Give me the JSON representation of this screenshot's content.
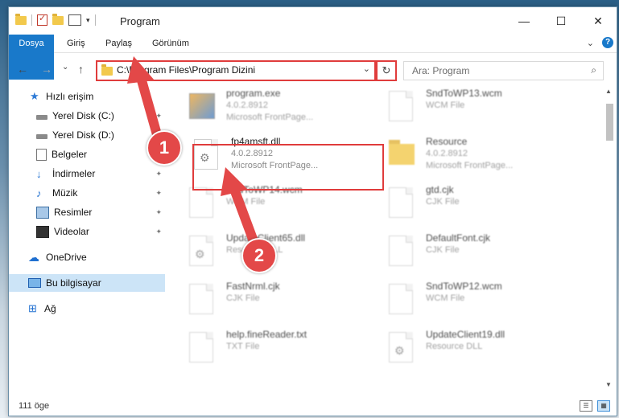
{
  "window": {
    "title": "Program",
    "controls": {
      "minimize": "—",
      "maximize": "☐",
      "close": "✕"
    }
  },
  "ribbon": {
    "tabs": [
      "Dosya",
      "Giriş",
      "Paylaş",
      "Görünüm"
    ],
    "help": "?",
    "expand": "⌄"
  },
  "nav": {
    "back": "←",
    "forward": "→",
    "recent": "⌄",
    "up": "↑",
    "address": "C:\\Program Files\\Program Dizini",
    "address_dropdown": "⌄",
    "refresh": "↻",
    "search_placeholder": "Ara: Program",
    "search_icon": "⌕"
  },
  "sidebar": {
    "items": [
      {
        "label": "Hızlı erişim",
        "icon": "star-icon"
      },
      {
        "label": "Yerel Disk (C:)",
        "icon": "disk-icon",
        "pinned": true
      },
      {
        "label": "Yerel Disk (D:)",
        "icon": "disk-icon",
        "pinned": true
      },
      {
        "label": "Belgeler",
        "icon": "documents-icon",
        "pinned": true
      },
      {
        "label": "İndirmeler",
        "icon": "downloads-icon",
        "pinned": true
      },
      {
        "label": "Müzik",
        "icon": "music-icon",
        "pinned": true
      },
      {
        "label": "Resimler",
        "icon": "pictures-icon",
        "pinned": true
      },
      {
        "label": "Videolar",
        "icon": "videos-icon",
        "pinned": true
      },
      {
        "label": "OneDrive",
        "icon": "onedrive-icon"
      },
      {
        "label": "Bu bilgisayar",
        "icon": "computer-icon",
        "selected": true
      },
      {
        "label": "Ağ",
        "icon": "network-icon"
      }
    ],
    "pin_glyph": "📌"
  },
  "files": [
    {
      "name": "program.exe",
      "line2": "4.0.2.8912",
      "line3": "Microsoft FrontPage...",
      "icon": "exe-icon"
    },
    {
      "name": "SndToWP13.wcm",
      "line2": "WCM File",
      "line3": "",
      "icon": "file-icon"
    },
    {
      "name": "fp4amsft.dll",
      "line2": "4.0.2.8912",
      "line3": "Microsoft FrontPage...",
      "icon": "dll-icon"
    },
    {
      "name": "Resource",
      "line2": "4.0.2.8912",
      "line3": "Microsoft FrontPage...",
      "icon": "folder-icon"
    },
    {
      "name": "SndToWP14.wcm",
      "line2": "WCM File",
      "line3": "",
      "icon": "file-icon"
    },
    {
      "name": "gtd.cjk",
      "line2": "CJK File",
      "line3": "",
      "icon": "file-icon"
    },
    {
      "name": "UpdateClient65.dll",
      "line2": "Resource DLL",
      "line3": "",
      "icon": "dll-icon"
    },
    {
      "name": "DefaultFont.cjk",
      "line2": "CJK File",
      "line3": "",
      "icon": "file-icon"
    },
    {
      "name": "FastNrml.cjk",
      "line2": "CJK File",
      "line3": "",
      "icon": "file-icon"
    },
    {
      "name": "SndToWP12.wcm",
      "line2": "WCM File",
      "line3": "",
      "icon": "file-icon"
    },
    {
      "name": "help.fineReader.txt",
      "line2": "TXT File",
      "line3": "",
      "icon": "file-icon"
    },
    {
      "name": "UpdateClient19.dll",
      "line2": "Resource DLL",
      "line3": "",
      "icon": "dll-icon"
    }
  ],
  "status": {
    "count": "111 öge"
  },
  "annotations": {
    "badge1": "1",
    "badge2": "2"
  },
  "colors": {
    "accent": "#1979ca",
    "highlight": "#e03c3c",
    "annotation": "#e34848",
    "selected": "#cce4f7"
  }
}
